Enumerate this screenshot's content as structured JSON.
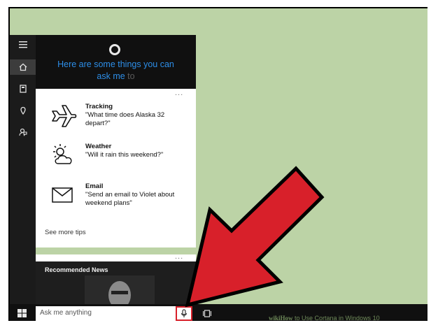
{
  "cortana": {
    "greeting_line1": "Here are some things you can",
    "greeting_line2a": "ask me ",
    "greeting_line2b": "to"
  },
  "tips": [
    {
      "title": "Tracking",
      "text": "\"What time does Alaska 32 depart?\"",
      "icon": "airplane-icon"
    },
    {
      "title": "Weather",
      "text": "\"Will it rain this weekend?\"",
      "icon": "weather-icon"
    },
    {
      "title": "Email",
      "text": "\"Send an email to Violet about weekend plans\"",
      "icon": "mail-icon"
    }
  ],
  "see_more": "See more tips",
  "more_dots": "...",
  "news_label": "Recommended News",
  "search_placeholder": "Ask me anything",
  "watermark": {
    "brand": "wikiHow",
    "text": " to Use Cortana in Windows 10"
  },
  "colors": {
    "cortana_blue": "#2d8ee8",
    "desktop_green": "#bcd3a6",
    "arrow_red": "#d8202a",
    "panel_dark": "#101010"
  },
  "rail_icons": [
    "hamburger-icon",
    "home-icon",
    "notebook-icon",
    "location-icon",
    "feedback-icon"
  ]
}
